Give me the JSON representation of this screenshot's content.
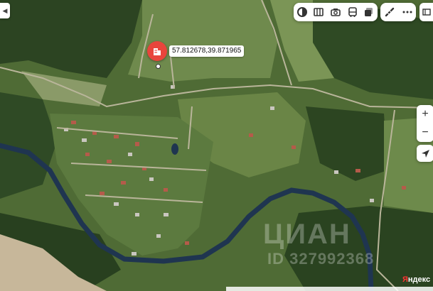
{
  "map": {
    "marker_coords": "57.812678,39.871965",
    "marker_icon": "building-icon",
    "marker_color": "#e8453c",
    "river_color": "#1f3550",
    "road_color": "#b9b59a"
  },
  "toolbar": {
    "layers": [
      {
        "name": "map-layer-icon"
      },
      {
        "name": "panorama-icon"
      },
      {
        "name": "camera-icon"
      },
      {
        "name": "transport-icon"
      },
      {
        "name": "layers-icon"
      }
    ],
    "tools": [
      {
        "name": "ruler-icon"
      },
      {
        "name": "more-icon"
      }
    ]
  },
  "zoom": {
    "in": "+",
    "out": "−"
  },
  "watermark": {
    "brand": "ЦИАН",
    "phone": "ID 327992368"
  },
  "attribution": {
    "y": "Я",
    "rest": "ндекс"
  }
}
